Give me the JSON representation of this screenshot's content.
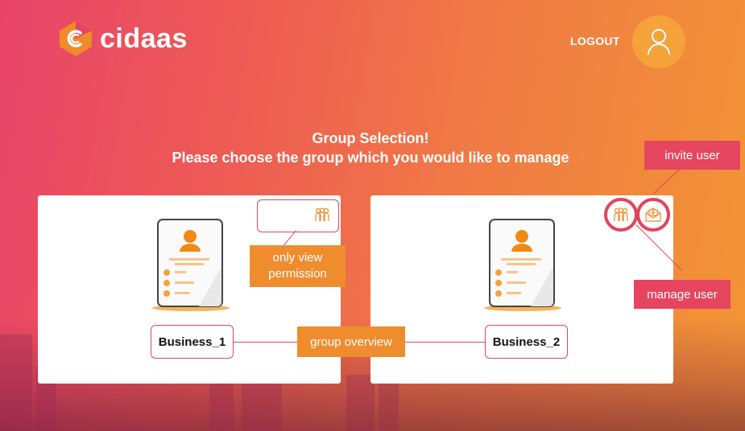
{
  "brand": {
    "name": "cidaas"
  },
  "header": {
    "logout_label": "LOGOUT",
    "avatar_icon": "user-icon"
  },
  "page": {
    "title": "Group Selection!",
    "subtitle": "Please choose the group which you would like to manage"
  },
  "groups": [
    {
      "name": "Business_1",
      "permission_icon": "group-icon"
    },
    {
      "name": "Business_2",
      "icons": [
        "group-icon",
        "mail-icon"
      ]
    }
  ],
  "annotations": {
    "only_view": "only view permission",
    "group_overview": "group overview",
    "invite_user": "invite user",
    "manage_user": "manage user"
  },
  "colors": {
    "accent_pink": "#e5455e",
    "accent_orange": "#ef8d2e",
    "avatar_bg": "#f5a23b"
  }
}
